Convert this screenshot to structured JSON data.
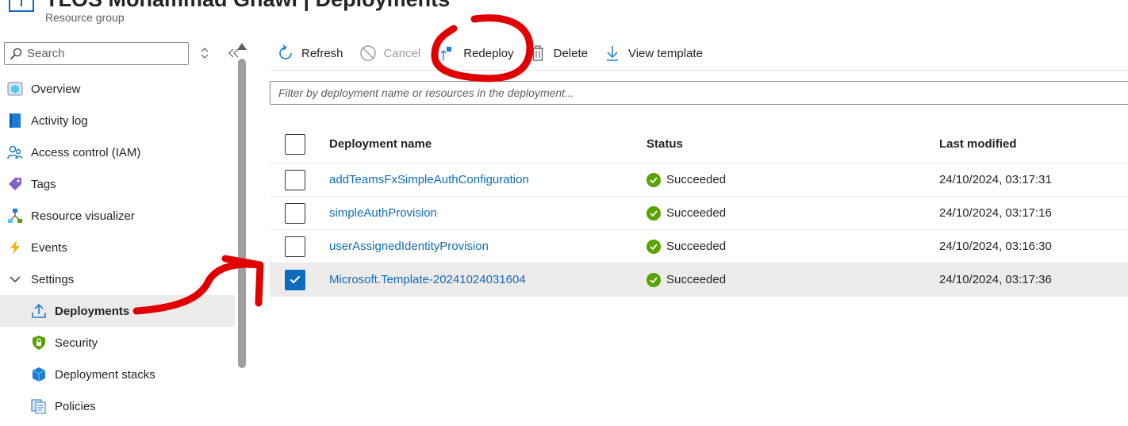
{
  "header": {
    "title": "TLOS Mohammad Ghawi | Deployments",
    "subtitle": "Resource group"
  },
  "sidebar": {
    "search_placeholder": "Search",
    "items": [
      {
        "label": "Overview",
        "icon": "overview-icon"
      },
      {
        "label": "Activity log",
        "icon": "activity-log-icon"
      },
      {
        "label": "Access control (IAM)",
        "icon": "iam-icon"
      },
      {
        "label": "Tags",
        "icon": "tag-icon"
      },
      {
        "label": "Resource visualizer",
        "icon": "resource-visualizer-icon"
      },
      {
        "label": "Events",
        "icon": "lightning-icon"
      },
      {
        "label": "Settings",
        "icon": "chevron-down-icon"
      },
      {
        "label": "Deployments",
        "icon": "upload-icon"
      },
      {
        "label": "Security",
        "icon": "shield-icon"
      },
      {
        "label": "Deployment stacks",
        "icon": "cube-icon"
      },
      {
        "label": "Policies",
        "icon": "policies-icon"
      }
    ],
    "selected": "Deployments"
  },
  "toolbar": {
    "refresh": "Refresh",
    "cancel": "Cancel",
    "redeploy": "Redeploy",
    "delete": "Delete",
    "view_template": "View template"
  },
  "filter": {
    "placeholder": "Filter by deployment name or resources in the deployment..."
  },
  "table": {
    "columns": [
      "Deployment name",
      "Status",
      "Last modified"
    ],
    "rows": [
      {
        "name": "addTeamsFxSimpleAuthConfiguration",
        "status": "Succeeded",
        "modified": "24/10/2024, 03:17:31",
        "checked": false
      },
      {
        "name": "simpleAuthProvision",
        "status": "Succeeded",
        "modified": "24/10/2024, 03:17:16",
        "checked": false
      },
      {
        "name": "userAssignedIdentityProvision",
        "status": "Succeeded",
        "modified": "24/10/2024, 03:16:30",
        "checked": false
      },
      {
        "name": "Microsoft.Template-20241024031604",
        "status": "Succeeded",
        "modified": "24/10/2024, 03:17:36",
        "checked": true
      }
    ]
  },
  "colors": {
    "link": "#0f6cbd",
    "success": "#57a300",
    "annotation": "#e00000"
  }
}
